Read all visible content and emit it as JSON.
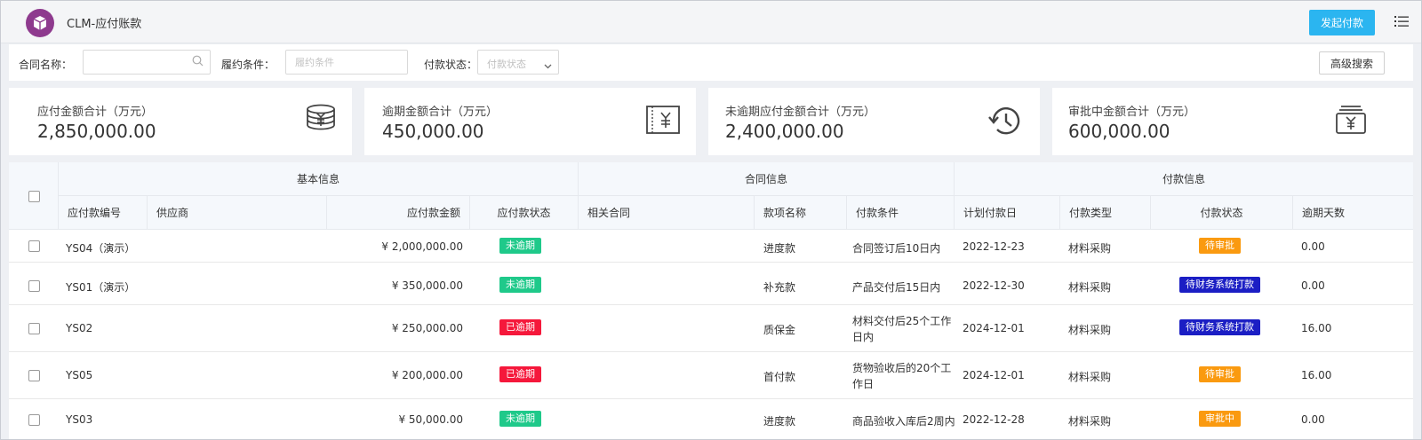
{
  "header": {
    "title": "CLM-应付账款",
    "initiate_payment_label": "发起付款"
  },
  "filters": {
    "contract_name_label": "合同名称：",
    "contract_name_value": "",
    "fulfillment_label": "履约条件：",
    "fulfillment_placeholder": "履约条件",
    "payment_status_label": "付款状态：",
    "payment_status_placeholder": "付款状态",
    "advanced_search_label": "高级搜索"
  },
  "cards": [
    {
      "label": "应付金额合计（万元）",
      "value": "2,850,000.00",
      "icon": "coins-icon"
    },
    {
      "label": "逾期金额合计（万元）",
      "value": "450,000.00",
      "icon": "yuan-bill-icon"
    },
    {
      "label": "未逾期应付金额合计（万元）",
      "value": "2,400,000.00",
      "icon": "history-clock-icon"
    },
    {
      "label": "审批中金额合计（万元）",
      "value": "600,000.00",
      "icon": "yuan-stack-icon"
    }
  ],
  "table": {
    "groups": {
      "basic": "基本信息",
      "contract": "合同信息",
      "payment": "付款信息"
    },
    "columns": {
      "code": "应付款编号",
      "supplier": "供应商",
      "amount": "应付款金额",
      "due_status": "应付款状态",
      "related_contract": "相关合同",
      "item_name": "款项名称",
      "condition": "付款条件",
      "plan_date": "计划付款日",
      "pay_type": "付款类型",
      "pay_status": "付款状态",
      "overdue_days": "逾期天数"
    },
    "rows": [
      {
        "code": "YS04（演示）",
        "supplier": "",
        "amount": "¥ 2,000,000.00",
        "due_status": "未逾期",
        "related_contract": "",
        "item_name": "进度款",
        "condition": "合同签订后10日内",
        "plan_date": "2022-12-23",
        "pay_type": "材料采购",
        "pay_status": "待审批",
        "overdue_days": "0.00"
      },
      {
        "code": "YS01（演示）",
        "supplier": "",
        "amount": "¥ 350,000.00",
        "due_status": "未逾期",
        "related_contract": "",
        "item_name": "补充款",
        "condition": "产品交付后15日内",
        "plan_date": "2022-12-30",
        "pay_type": "材料采购",
        "pay_status": "待财务系统打款",
        "overdue_days": "0.00"
      },
      {
        "code": "YS02",
        "supplier": "",
        "amount": "¥ 250,000.00",
        "due_status": "已逾期",
        "related_contract": "",
        "item_name": "质保金",
        "condition": "材料交付后25个工作日内",
        "plan_date": "2024-12-01",
        "pay_type": "材料采购",
        "pay_status": "待财务系统打款",
        "overdue_days": "16.00"
      },
      {
        "code": "YS05",
        "supplier": "",
        "amount": "¥ 200,000.00",
        "due_status": "已逾期",
        "related_contract": "",
        "item_name": "首付款",
        "condition": "货物验收后的20个工作日",
        "plan_date": "2024-12-01",
        "pay_type": "材料采购",
        "pay_status": "待审批",
        "overdue_days": "16.00"
      },
      {
        "code": "YS03",
        "supplier": "",
        "amount": "¥ 50,000.00",
        "due_status": "未逾期",
        "related_contract": "",
        "item_name": "进度款",
        "condition": "商品验收入库后2周内",
        "plan_date": "2022-12-28",
        "pay_type": "材料采购",
        "pay_status": "审批中",
        "overdue_days": "0.00"
      }
    ]
  },
  "colors": {
    "primary_button": "#2bb5f0",
    "logo": "#8e3a8e",
    "not_overdue": "#1fc98a",
    "overdue": "#f5183b",
    "pending_approval": "#fa9a10",
    "pending_finance": "#1b1ec4",
    "in_approval": "#fa9a10"
  }
}
